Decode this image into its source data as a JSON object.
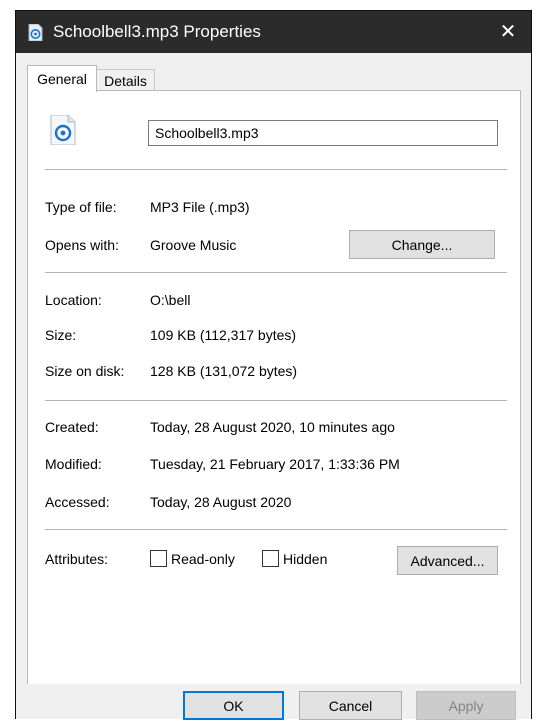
{
  "window": {
    "title": "Schoolbell3.mp3 Properties",
    "title_icon": "audio-file-icon",
    "close_glyph": "✕"
  },
  "tabs": [
    {
      "label": "General",
      "active": true
    },
    {
      "label": "Details",
      "active": false
    }
  ],
  "general": {
    "file_icon": "audio-file-icon",
    "filename": "Schoolbell3.mp3",
    "type_label": "Type of file:",
    "type_value": "MP3 File (.mp3)",
    "opens_label": "Opens with:",
    "opens_value": "Groove Music",
    "change_button": "Change...",
    "location_label": "Location:",
    "location_value": "O:\\bell",
    "size_label": "Size:",
    "size_value": "109 KB (112,317 bytes)",
    "size_disk_label": "Size on disk:",
    "size_disk_value": "128 KB (131,072 bytes)",
    "created_label": "Created:",
    "created_value": "Today, 28 August 2020, 10 minutes ago",
    "modified_label": "Modified:",
    "modified_value": "Tuesday, 21 February 2017, 1:33:36 PM",
    "accessed_label": "Accessed:",
    "accessed_value": "Today, 28 August 2020",
    "attributes_label": "Attributes:",
    "readonly_label": "Read-only",
    "readonly_checked": false,
    "hidden_label": "Hidden",
    "hidden_checked": false,
    "advanced_button": "Advanced..."
  },
  "footer": {
    "ok": "OK",
    "cancel": "Cancel",
    "apply": "Apply",
    "apply_enabled": false
  },
  "colors": {
    "titlebar": "#2b2b2b",
    "accent": "#0078d7",
    "dialog_bg": "#f0f0f0",
    "panel_bg": "#ffffff"
  }
}
